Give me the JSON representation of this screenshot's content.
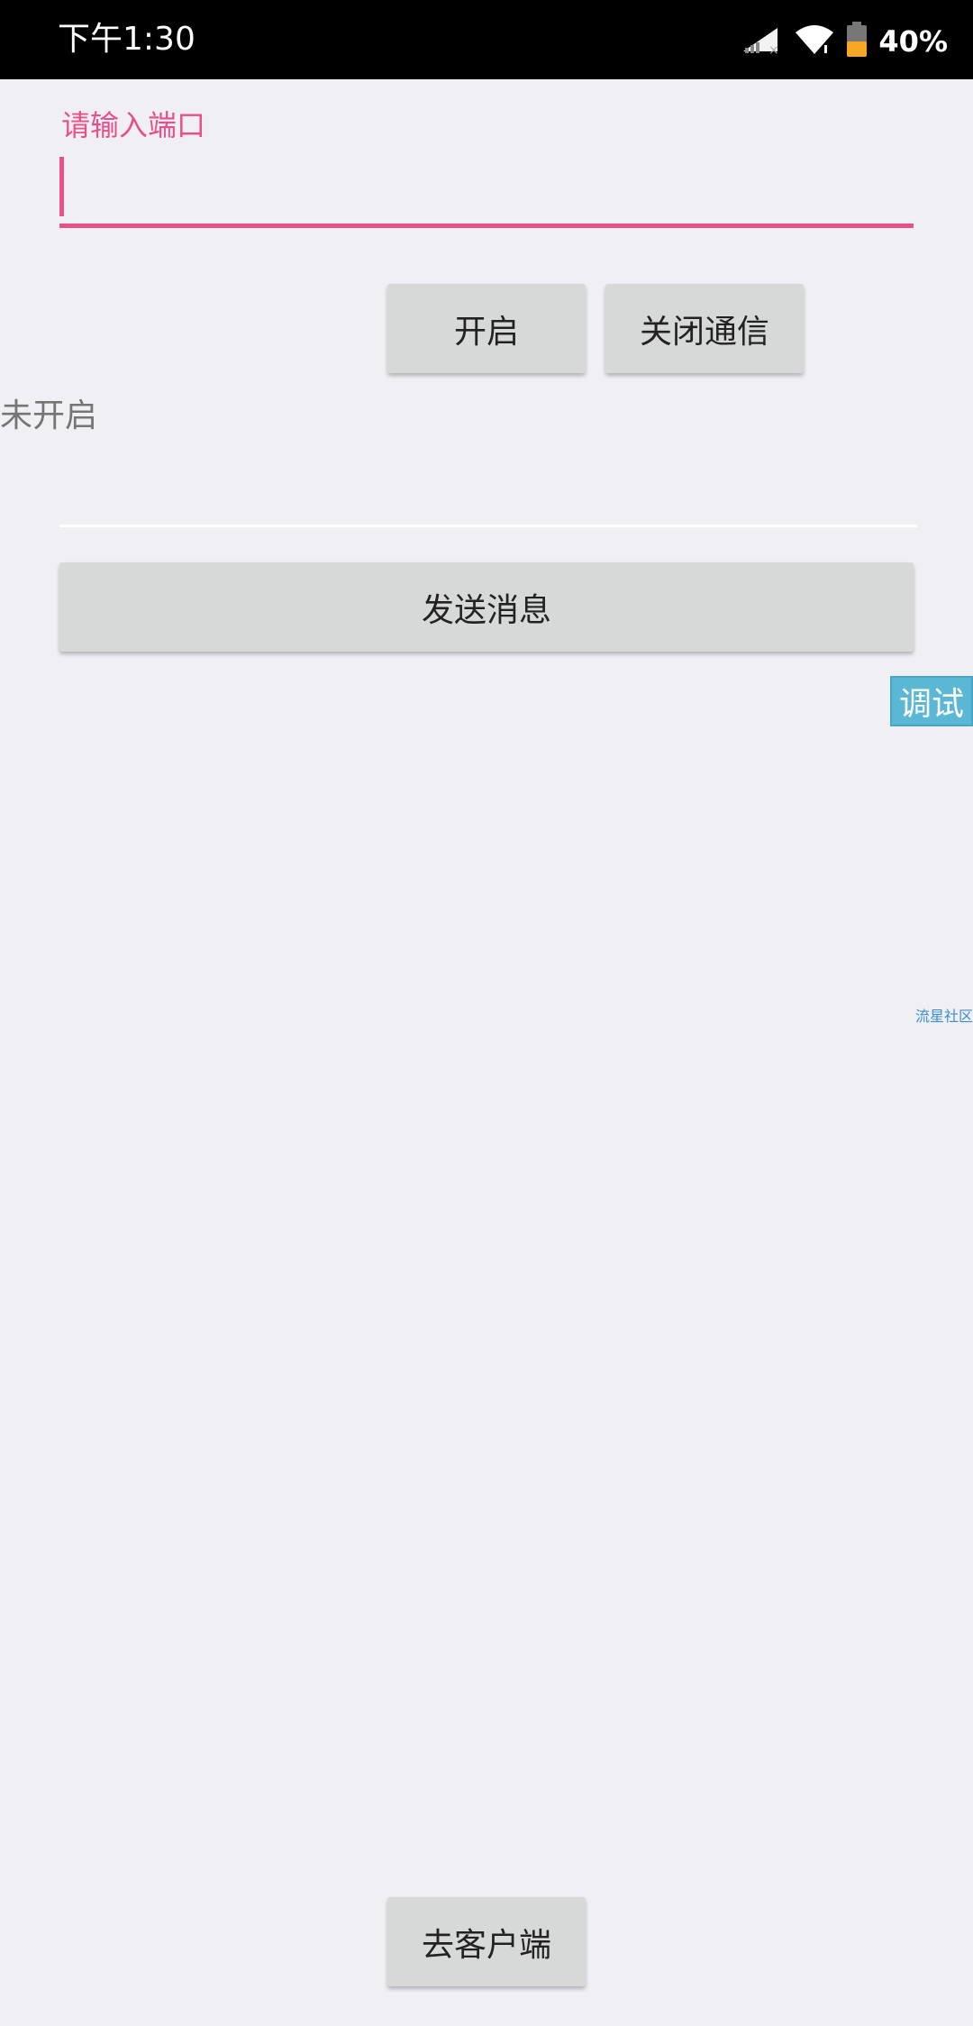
{
  "status_bar": {
    "time": "下午1:30",
    "battery_percent": "40%",
    "icons": [
      "signal-icon",
      "wifi-icon",
      "battery-icon"
    ],
    "battery_level": 0.4,
    "battery_color": "#f5a623"
  },
  "form": {
    "port_label": "请输入端口",
    "port_value": "",
    "message_value": ""
  },
  "buttons": {
    "open": "开启",
    "close": "关闭通信",
    "send": "发送消息",
    "client": "去客户端"
  },
  "status_text": "未开启",
  "debug_tag": "调试",
  "watermark": "流星社区",
  "colors": {
    "accent": "#e8508a",
    "button_bg": "#d7d8d8",
    "debug_bg": "#5bb8d4"
  }
}
